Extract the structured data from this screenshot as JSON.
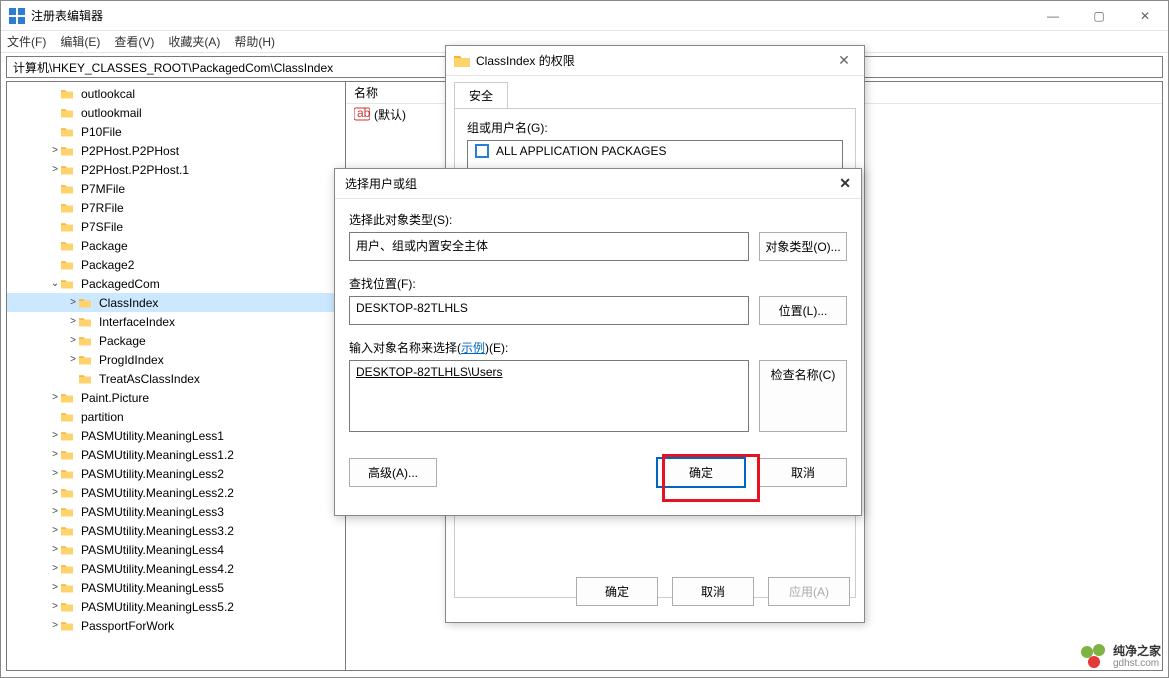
{
  "window": {
    "title": "注册表编辑器",
    "controls": {
      "min": "—",
      "max": "▢",
      "close": "✕"
    }
  },
  "menu": {
    "file": "文件(F)",
    "edit": "编辑(E)",
    "view": "查看(V)",
    "favorites": "收藏夹(A)",
    "help": "帮助(H)"
  },
  "address": "计算机\\HKEY_CLASSES_ROOT\\PackagedCom\\ClassIndex",
  "tree": [
    {
      "indent": 2,
      "exp": "",
      "label": "outlookcal"
    },
    {
      "indent": 2,
      "exp": "",
      "label": "outlookmail"
    },
    {
      "indent": 2,
      "exp": "",
      "label": "P10File"
    },
    {
      "indent": 2,
      "exp": ">",
      "label": "P2PHost.P2PHost"
    },
    {
      "indent": 2,
      "exp": ">",
      "label": "P2PHost.P2PHost.1"
    },
    {
      "indent": 2,
      "exp": "",
      "label": "P7MFile"
    },
    {
      "indent": 2,
      "exp": "",
      "label": "P7RFile"
    },
    {
      "indent": 2,
      "exp": "",
      "label": "P7SFile"
    },
    {
      "indent": 2,
      "exp": "",
      "label": "Package"
    },
    {
      "indent": 2,
      "exp": "",
      "label": "Package2"
    },
    {
      "indent": 2,
      "exp": "v",
      "label": "PackagedCom"
    },
    {
      "indent": 3,
      "exp": ">",
      "label": "ClassIndex",
      "selected": true
    },
    {
      "indent": 3,
      "exp": ">",
      "label": "InterfaceIndex"
    },
    {
      "indent": 3,
      "exp": ">",
      "label": "Package"
    },
    {
      "indent": 3,
      "exp": ">",
      "label": "ProgIdIndex"
    },
    {
      "indent": 3,
      "exp": "",
      "label": "TreatAsClassIndex"
    },
    {
      "indent": 2,
      "exp": ">",
      "label": "Paint.Picture"
    },
    {
      "indent": 2,
      "exp": "",
      "label": "partition"
    },
    {
      "indent": 2,
      "exp": ">",
      "label": "PASMUtility.MeaningLess1"
    },
    {
      "indent": 2,
      "exp": ">",
      "label": "PASMUtility.MeaningLess1.2"
    },
    {
      "indent": 2,
      "exp": ">",
      "label": "PASMUtility.MeaningLess2"
    },
    {
      "indent": 2,
      "exp": ">",
      "label": "PASMUtility.MeaningLess2.2"
    },
    {
      "indent": 2,
      "exp": ">",
      "label": "PASMUtility.MeaningLess3"
    },
    {
      "indent": 2,
      "exp": ">",
      "label": "PASMUtility.MeaningLess3.2"
    },
    {
      "indent": 2,
      "exp": ">",
      "label": "PASMUtility.MeaningLess4"
    },
    {
      "indent": 2,
      "exp": ">",
      "label": "PASMUtility.MeaningLess4.2"
    },
    {
      "indent": 2,
      "exp": ">",
      "label": "PASMUtility.MeaningLess5"
    },
    {
      "indent": 2,
      "exp": ">",
      "label": "PASMUtility.MeaningLess5.2"
    },
    {
      "indent": 2,
      "exp": ">",
      "label": "PassportForWork"
    }
  ],
  "values": {
    "col_name": "名称",
    "default_name": "(默认)"
  },
  "perm_dialog": {
    "title": "ClassIndex 的权限",
    "tab_security": "安全",
    "group_label": "组或用户名(G):",
    "user_all_packages": "ALL APPLICATION PACKAGES",
    "btn_ok": "确定",
    "btn_cancel": "取消",
    "btn_apply": "应用(A)"
  },
  "select_dialog": {
    "title": "选择用户或组",
    "label_object_type": "选择此对象类型(S):",
    "object_type_value": "用户、组或内置安全主体",
    "btn_object_types": "对象类型(O)...",
    "label_location": "查找位置(F):",
    "location_value": "DESKTOP-82TLHLS",
    "btn_locations": "位置(L)...",
    "label_names_prefix": "输入对象名称来选择(",
    "label_names_example": "示例",
    "label_names_suffix": ")(E):",
    "names_value": "DESKTOP-82TLHLS\\Users",
    "btn_check_names": "检查名称(C)",
    "btn_advanced": "高级(A)...",
    "btn_ok": "确定",
    "btn_cancel": "取消"
  },
  "watermark": {
    "name": "纯净之家",
    "url": "gdhst.com"
  }
}
